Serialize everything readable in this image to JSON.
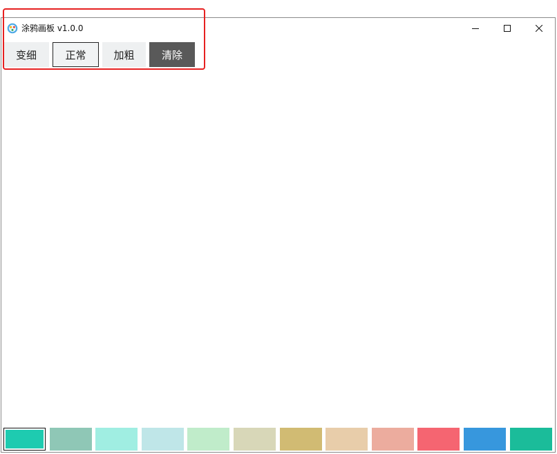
{
  "window": {
    "title": "涂鸦画板 v1.0.0"
  },
  "window_controls": {
    "minimize_icon": "minimize-icon",
    "maximize_icon": "maximize-icon",
    "close_icon": "close-icon"
  },
  "toolbar": {
    "thinner_label": "变细",
    "normal_label": "正常",
    "thicker_label": "加粗",
    "clear_label": "清除"
  },
  "palette": {
    "colors": [
      "#1ecbb0",
      "#8fc7b6",
      "#a0eee2",
      "#bfe6e8",
      "#c0ecca",
      "#d8d7b8",
      "#d1bb73",
      "#e8cdaa",
      "#ecac9e",
      "#f56571",
      "#3797dd",
      "#1bbc9a"
    ],
    "selected_index": 0
  },
  "colors": {
    "highlight": "#e62020",
    "clear_button_bg": "#595959"
  }
}
